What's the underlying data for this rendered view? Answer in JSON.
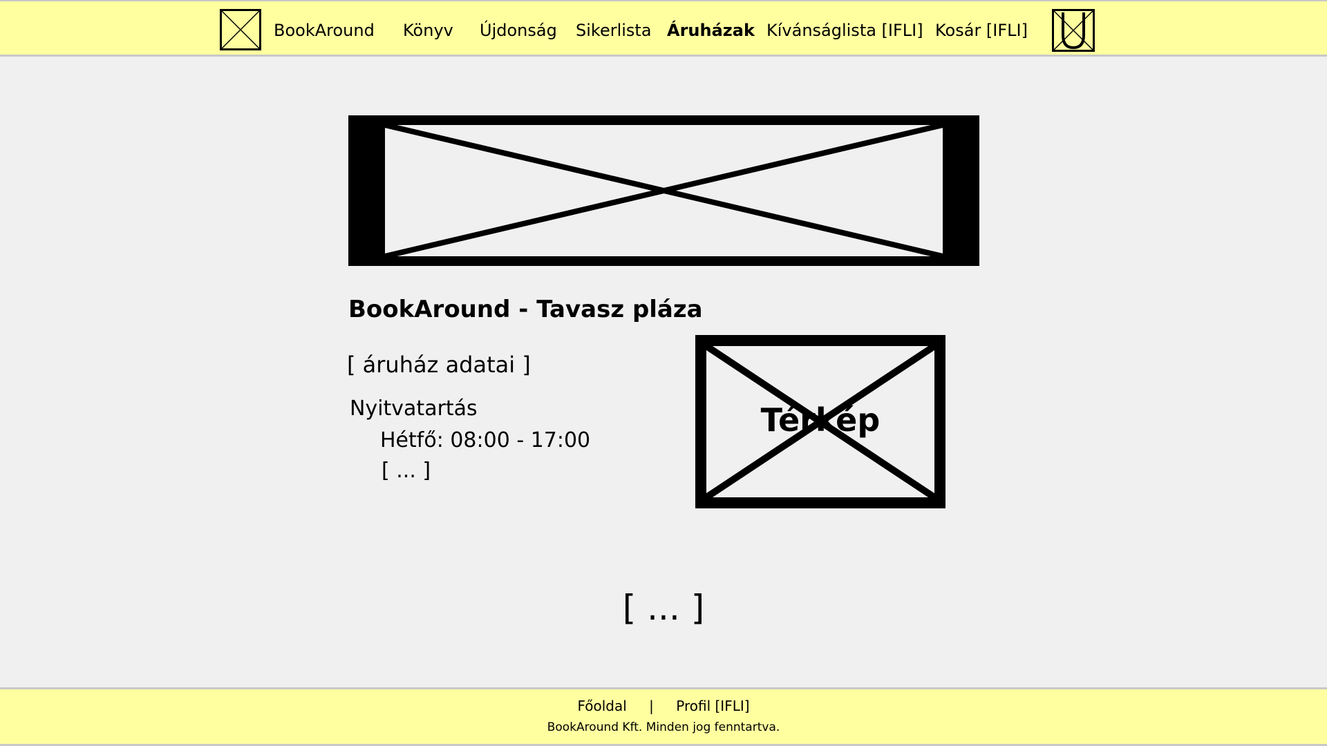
{
  "header": {
    "logo_icon": "placeholder-image-icon",
    "brand": "BookAround",
    "nav": [
      {
        "label": "Könyv",
        "active": false
      },
      {
        "label": "Újdonság",
        "active": false
      },
      {
        "label": "Sikerlista",
        "active": false
      },
      {
        "label": "Áruházak",
        "active": true
      },
      {
        "label": "Kívánságlista [IFLI]",
        "active": false
      },
      {
        "label": "Kosár [IFLI]",
        "active": false
      }
    ],
    "user_icon": "user-icon",
    "background_color": "#ffffa0"
  },
  "main": {
    "banner_icon": "placeholder-image-icon",
    "store_title": "BookAround - Tavasz pláza",
    "store_data": "[ áruház adatai ]",
    "hours_heading": "Nyitvatartás",
    "hours_monday": "Hétfő: 08:00 - 17:00",
    "hours_more": "[ ... ]",
    "map_label": "Térkép",
    "more_content": "[ ... ]"
  },
  "footer": {
    "links": [
      "Főoldal",
      "Profil [IFLI]"
    ],
    "separator": "|",
    "copyright": "BookAround Kft. Minden jog fenntartva."
  }
}
